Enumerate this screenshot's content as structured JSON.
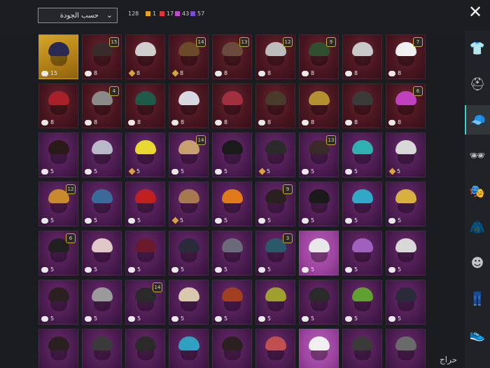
{
  "header": {
    "sort_label": "حسب الجودة",
    "total": "128",
    "rarities": [
      {
        "color": "#e8a21a",
        "count": "1"
      },
      {
        "color": "#e0353b",
        "count": "17"
      },
      {
        "color": "#c44ad0",
        "count": "43"
      },
      {
        "color": "#7b4ad0",
        "count": "57"
      }
    ]
  },
  "grid": {
    "rows": [
      [
        {
          "rarity": "gold",
          "currency": "cloud",
          "copies": "15",
          "badge": "",
          "art": "#2a2a52"
        },
        {
          "rarity": "red",
          "currency": "cloud",
          "copies": "8",
          "badge": "15",
          "art": "#3a2b2b"
        },
        {
          "rarity": "red",
          "currency": "diamond",
          "copies": "8",
          "badge": "",
          "art": "#cfcfcf"
        },
        {
          "rarity": "red",
          "currency": "diamond",
          "copies": "8",
          "badge": "14",
          "art": "#6b4a2a"
        },
        {
          "rarity": "red",
          "currency": "cloud",
          "copies": "8",
          "badge": "13",
          "art": "#6a4a3a"
        },
        {
          "rarity": "red",
          "currency": "cloud",
          "copies": "8",
          "badge": "12",
          "art": "#bdbdbd"
        },
        {
          "rarity": "red",
          "currency": "cloud",
          "copies": "8",
          "badge": "9",
          "art": "#2f4f2f"
        },
        {
          "rarity": "red",
          "currency": "cloud",
          "copies": "8",
          "badge": "",
          "art": "#c9c9c9"
        },
        {
          "rarity": "red",
          "currency": "cloud",
          "copies": "8",
          "badge": "7",
          "art": "#f0f0f0"
        }
      ],
      [
        {
          "rarity": "red",
          "currency": "cloud",
          "copies": "8",
          "badge": "",
          "art": "#a8202a"
        },
        {
          "rarity": "red",
          "currency": "cloud",
          "copies": "8",
          "badge": "4",
          "art": "#8a8a8a"
        },
        {
          "rarity": "red",
          "currency": "cloud",
          "copies": "8",
          "badge": "",
          "art": "#1f5a4a"
        },
        {
          "rarity": "red",
          "currency": "cloud",
          "copies": "8",
          "badge": "",
          "art": "#d8d8e0"
        },
        {
          "rarity": "red",
          "currency": "cloud",
          "copies": "8",
          "badge": "",
          "art": "#a03040"
        },
        {
          "rarity": "red",
          "currency": "cloud",
          "copies": "8",
          "badge": "",
          "art": "#4a3a2a"
        },
        {
          "rarity": "red",
          "currency": "cloud",
          "copies": "8",
          "badge": "",
          "art": "#b59030"
        },
        {
          "rarity": "red",
          "currency": "cloud",
          "copies": "8",
          "badge": "",
          "art": "#3a3a3a"
        },
        {
          "rarity": "red",
          "currency": "cloud",
          "copies": "8",
          "badge": "6",
          "art": "#c040c0"
        }
      ],
      [
        {
          "rarity": "purple",
          "currency": "cloud",
          "copies": "5",
          "badge": "",
          "art": "#2a1a1a"
        },
        {
          "rarity": "purple",
          "currency": "cloud",
          "copies": "5",
          "badge": "",
          "art": "#b8b8c8"
        },
        {
          "rarity": "purple",
          "currency": "diamond",
          "copies": "5",
          "badge": "",
          "art": "#e8d830"
        },
        {
          "rarity": "purple",
          "currency": "cloud",
          "copies": "5",
          "badge": "14",
          "art": "#c8a070"
        },
        {
          "rarity": "purple",
          "currency": "cloud",
          "copies": "5",
          "badge": "",
          "art": "#1a1a1a"
        },
        {
          "rarity": "purple",
          "currency": "diamond",
          "copies": "5",
          "badge": "",
          "art": "#2a2a2a"
        },
        {
          "rarity": "purple",
          "currency": "cloud",
          "copies": "5",
          "badge": "13",
          "art": "#3a2a2a"
        },
        {
          "rarity": "purple",
          "currency": "cloud",
          "copies": "5",
          "badge": "",
          "art": "#30b0b0"
        },
        {
          "rarity": "purple",
          "currency": "diamond",
          "copies": "5",
          "badge": "",
          "art": "#d8d8d8"
        }
      ],
      [
        {
          "rarity": "purple",
          "currency": "cloud",
          "copies": "5",
          "badge": "12",
          "art": "#c88a2a"
        },
        {
          "rarity": "purple",
          "currency": "cloud",
          "copies": "5",
          "badge": "",
          "art": "#3a6a9a"
        },
        {
          "rarity": "purple",
          "currency": "cloud",
          "copies": "5",
          "badge": "",
          "art": "#c02020"
        },
        {
          "rarity": "purple",
          "currency": "diamond",
          "copies": "5",
          "badge": "",
          "art": "#a87850"
        },
        {
          "rarity": "purple",
          "currency": "cloud",
          "copies": "5",
          "badge": "",
          "art": "#e07a1a"
        },
        {
          "rarity": "purple",
          "currency": "cloud",
          "copies": "5",
          "badge": "9",
          "art": "#2a2020"
        },
        {
          "rarity": "purple",
          "currency": "cloud",
          "copies": "5",
          "badge": "",
          "art": "#1a1a1a"
        },
        {
          "rarity": "purple",
          "currency": "cloud",
          "copies": "5",
          "badge": "",
          "art": "#30a8c8"
        },
        {
          "rarity": "purple",
          "currency": "cloud",
          "copies": "5",
          "badge": "",
          "art": "#d8b040"
        }
      ],
      [
        {
          "rarity": "purple",
          "currency": "cloud",
          "copies": "5",
          "badge": "6",
          "art": "#202020"
        },
        {
          "rarity": "purple",
          "currency": "cloud",
          "copies": "5",
          "badge": "",
          "art": "#e0c8c8"
        },
        {
          "rarity": "purple",
          "currency": "cloud",
          "copies": "5",
          "badge": "",
          "art": "#6a1a2a"
        },
        {
          "rarity": "purple",
          "currency": "cloud",
          "copies": "5",
          "badge": "",
          "art": "#2a2a3a"
        },
        {
          "rarity": "purple",
          "currency": "cloud",
          "copies": "5",
          "badge": "",
          "art": "#6a6a7a"
        },
        {
          "rarity": "purple",
          "currency": "cloud",
          "copies": "5",
          "badge": "3",
          "art": "#2a5a6a"
        },
        {
          "rarity": "pink",
          "currency": "cloud",
          "copies": "5",
          "badge": "",
          "art": "#e8e8e8"
        },
        {
          "rarity": "purple",
          "currency": "cloud",
          "copies": "5",
          "badge": "",
          "art": "#a060c0"
        },
        {
          "rarity": "purple",
          "currency": "cloud",
          "copies": "5",
          "badge": "",
          "art": "#d8d8d8"
        }
      ],
      [
        {
          "rarity": "purple",
          "currency": "cloud",
          "copies": "5",
          "badge": "",
          "art": "#2a2020"
        },
        {
          "rarity": "purple",
          "currency": "cloud",
          "copies": "5",
          "badge": "",
          "art": "#9a9a9a"
        },
        {
          "rarity": "purple",
          "currency": "cloud",
          "copies": "5",
          "badge": "14",
          "art": "#2a2a2a"
        },
        {
          "rarity": "purple",
          "currency": "cloud",
          "copies": "5",
          "badge": "",
          "art": "#d8c8b0"
        },
        {
          "rarity": "purple",
          "currency": "cloud",
          "copies": "5",
          "badge": "",
          "art": "#a04020"
        },
        {
          "rarity": "purple",
          "currency": "cloud",
          "copies": "5",
          "badge": "",
          "art": "#a0a030"
        },
        {
          "rarity": "purple",
          "currency": "cloud",
          "copies": "5",
          "badge": "",
          "art": "#2a2a2a"
        },
        {
          "rarity": "purple",
          "currency": "cloud",
          "copies": "5",
          "badge": "",
          "art": "#60a030"
        },
        {
          "rarity": "purple",
          "currency": "cloud",
          "copies": "5",
          "badge": "",
          "art": "#2a2a3a"
        }
      ],
      [
        {
          "rarity": "purple",
          "currency": "cloud",
          "copies": "",
          "badge": "",
          "art": "#2a2020"
        },
        {
          "rarity": "purple",
          "currency": "cloud",
          "copies": "",
          "badge": "",
          "art": "#3a3a3a"
        },
        {
          "rarity": "purple",
          "currency": "cloud",
          "copies": "",
          "badge": "",
          "art": "#2a2a2a"
        },
        {
          "rarity": "purple",
          "currency": "cloud",
          "copies": "",
          "badge": "",
          "art": "#30a0c0"
        },
        {
          "rarity": "purple",
          "currency": "cloud",
          "copies": "",
          "badge": "",
          "art": "#2a2020"
        },
        {
          "rarity": "purple",
          "currency": "cloud",
          "copies": "",
          "badge": "",
          "art": "#c05050"
        },
        {
          "rarity": "pink",
          "currency": "cloud",
          "copies": "",
          "badge": "",
          "art": "#f0f0f0"
        },
        {
          "rarity": "purple",
          "currency": "cloud",
          "copies": "",
          "badge": "",
          "art": "#3a3a3a"
        },
        {
          "rarity": "purple",
          "currency": "cloud",
          "copies": "",
          "badge": "",
          "art": "#6a6a6a"
        }
      ]
    ]
  },
  "sidebar": {
    "items": [
      {
        "name": "outfit-icon",
        "glyph": "👕"
      },
      {
        "name": "helmet-icon",
        "glyph": "⛑"
      },
      {
        "name": "hat-icon",
        "glyph": "🧢"
      },
      {
        "name": "glasses-icon",
        "glyph": "🕶"
      },
      {
        "name": "mask-icon",
        "glyph": "🎭"
      },
      {
        "name": "jacket-icon",
        "glyph": "🧥"
      },
      {
        "name": "face-icon",
        "glyph": "☻"
      },
      {
        "name": "pants-icon",
        "glyph": "👖"
      },
      {
        "name": "shoes-icon",
        "glyph": "👟"
      }
    ],
    "active_index": 2
  },
  "watermark": "حراج"
}
